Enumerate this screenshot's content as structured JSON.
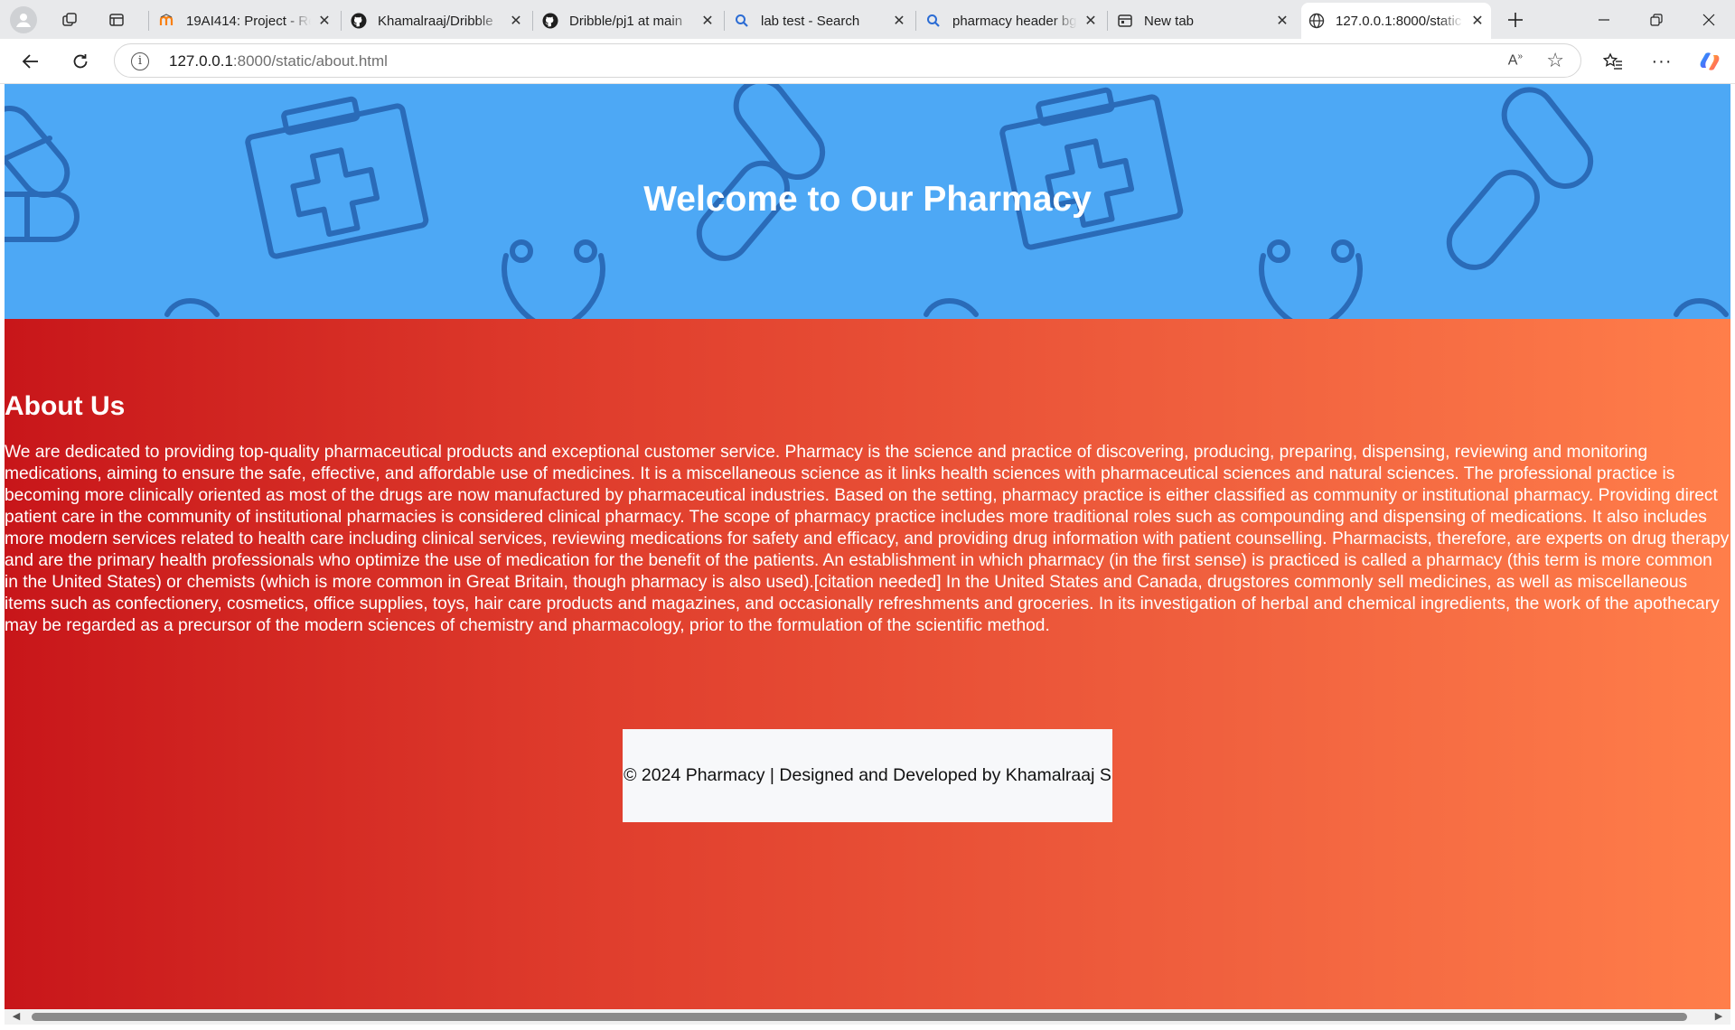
{
  "browser": {
    "tabs": [
      {
        "title": "19AI414: Project - Re",
        "favicon": "moodle-icon",
        "active": false
      },
      {
        "title": "Khamalraaj/Dribble",
        "favicon": "github-icon",
        "active": false
      },
      {
        "title": "Dribble/pj1 at main",
        "favicon": "github-icon",
        "active": false
      },
      {
        "title": "lab test - Search",
        "favicon": "search-icon",
        "active": false
      },
      {
        "title": "pharmacy header bg",
        "favicon": "search-icon",
        "active": false
      },
      {
        "title": "New tab",
        "favicon": "newtab-icon",
        "active": false
      },
      {
        "title": "127.0.0.1:8000/static",
        "favicon": "globe-icon",
        "active": true
      }
    ],
    "url_host": "127.0.0.1",
    "url_rest": ":8000/static/about.html"
  },
  "page": {
    "hero_title": "Welcome to Our Pharmacy",
    "about_title": "About Us",
    "about_text": "We are dedicated to providing top-quality pharmaceutical products and exceptional customer service. Pharmacy is the science and practice of discovering, producing, preparing, dispensing, reviewing and monitoring medications, aiming to ensure the safe, effective, and affordable use of medicines. It is a miscellaneous science as it links health sciences with pharmaceutical sciences and natural sciences. The professional practice is becoming more clinically oriented as most of the drugs are now manufactured by pharmaceutical industries. Based on the setting, pharmacy practice is either classified as community or institutional pharmacy. Providing direct patient care in the community of institutional pharmacies is considered clinical pharmacy. The scope of pharmacy practice includes more traditional roles such as compounding and dispensing of medications. It also includes more modern services related to health care including clinical services, reviewing medications for safety and efficacy, and providing drug information with patient counselling. Pharmacists, therefore, are experts on drug therapy and are the primary health professionals who optimize the use of medication for the benefit of the patients. An establishment in which pharmacy (in the first sense) is practiced is called a pharmacy (this term is more common in the United States) or chemists (which is more common in Great Britain, though pharmacy is also used).[citation needed] In the United States and Canada, drugstores commonly sell medicines, as well as miscellaneous items such as confectionery, cosmetics, office supplies, toys, hair care products and magazines, and occasionally refreshments and groceries. In its investigation of herbal and chemical ingredients, the work of the apothecary may be regarded as a precursor of the modern sciences of chemistry and pharmacology, prior to the formulation of the scientific method.",
    "footer_text": "© 2024 Pharmacy | Designed and Developed by Khamalraaj S"
  },
  "colors": {
    "hero_bg": "#4da8f5",
    "hero_pattern": "#2a6bb8",
    "gradient_start": "#c8161a",
    "gradient_end": "#ff7e4a",
    "footer_bg": "#f7f8fa"
  }
}
